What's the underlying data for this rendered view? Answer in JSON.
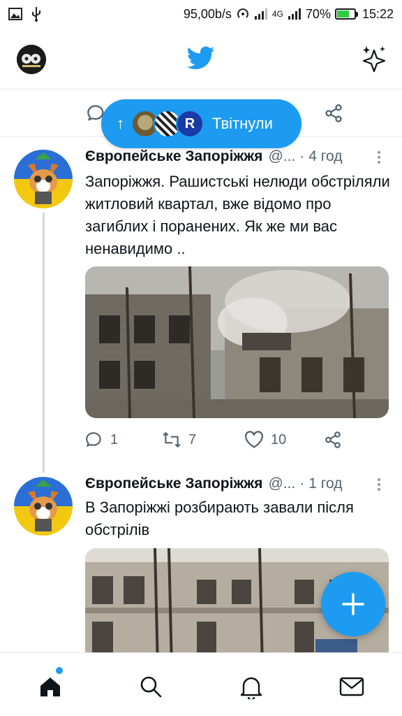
{
  "status_bar": {
    "speed": "95,00b/s",
    "network": "4G",
    "battery_percent": "70%",
    "battery_level": 0.7,
    "time": "15:22"
  },
  "header": {
    "logo_icon": "twitter-bird-icon",
    "sparkle_icon": "sparkle-icon"
  },
  "new_tweets_pill": {
    "label": "Твітнули"
  },
  "tweets": [
    {
      "name": "Європейське Запоріжжя",
      "handle": "@...",
      "time": "4 год",
      "text": "Запоріжжя. Рашистські нелюди обстріляли житловий квартал, вже відомо про загиблих і поранених. Як же ми вас ненавидимо ..",
      "replies": "1",
      "retweets": "7",
      "likes": "10"
    },
    {
      "name": "Європейське Запоріжжя",
      "handle": "@...",
      "time": "1 год",
      "text": "В Запоріжжі розбирають завали після обстрілів"
    }
  ],
  "colors": {
    "accent": "#1d9bf0",
    "text": "#0f1419",
    "muted": "#536471",
    "divider": "#e6ecf0"
  },
  "nav": {
    "items": [
      "home-icon",
      "search-icon",
      "notifications-icon",
      "messages-icon"
    ]
  }
}
